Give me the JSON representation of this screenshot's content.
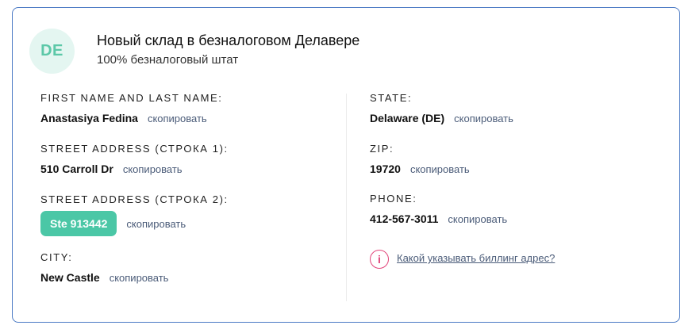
{
  "header": {
    "avatar_text": "DE",
    "title": "Новый склад в безналоговом Делавере",
    "subtitle": "100% безналоговый штат"
  },
  "copy_label": "скопировать",
  "left_fields": {
    "name": {
      "label": "FIRST NAME AND LAST NAME:",
      "value": "Anastasiya Fedina"
    },
    "street1": {
      "label": "STREET ADDRESS (СТРОКА 1):",
      "value": "510 Carroll Dr"
    },
    "street2": {
      "label": "STREET ADDRESS (СТРОКА 2):",
      "value": "Ste 913442"
    },
    "city": {
      "label": "CITY:",
      "value": "New Castle"
    }
  },
  "right_fields": {
    "state": {
      "label": "STATE:",
      "value": "Delaware (DE)"
    },
    "zip": {
      "label": "ZIP:",
      "value": "19720"
    },
    "phone": {
      "label": "PHONE:",
      "value": "412-567-3011"
    }
  },
  "help": {
    "icon_symbol": "i",
    "text": "Какой указывать биллинг адрес?"
  },
  "colors": {
    "accent": "#4bc7a6",
    "border": "#4a79c4",
    "link": "#4a5b78",
    "help_icon": "#e2457a"
  }
}
